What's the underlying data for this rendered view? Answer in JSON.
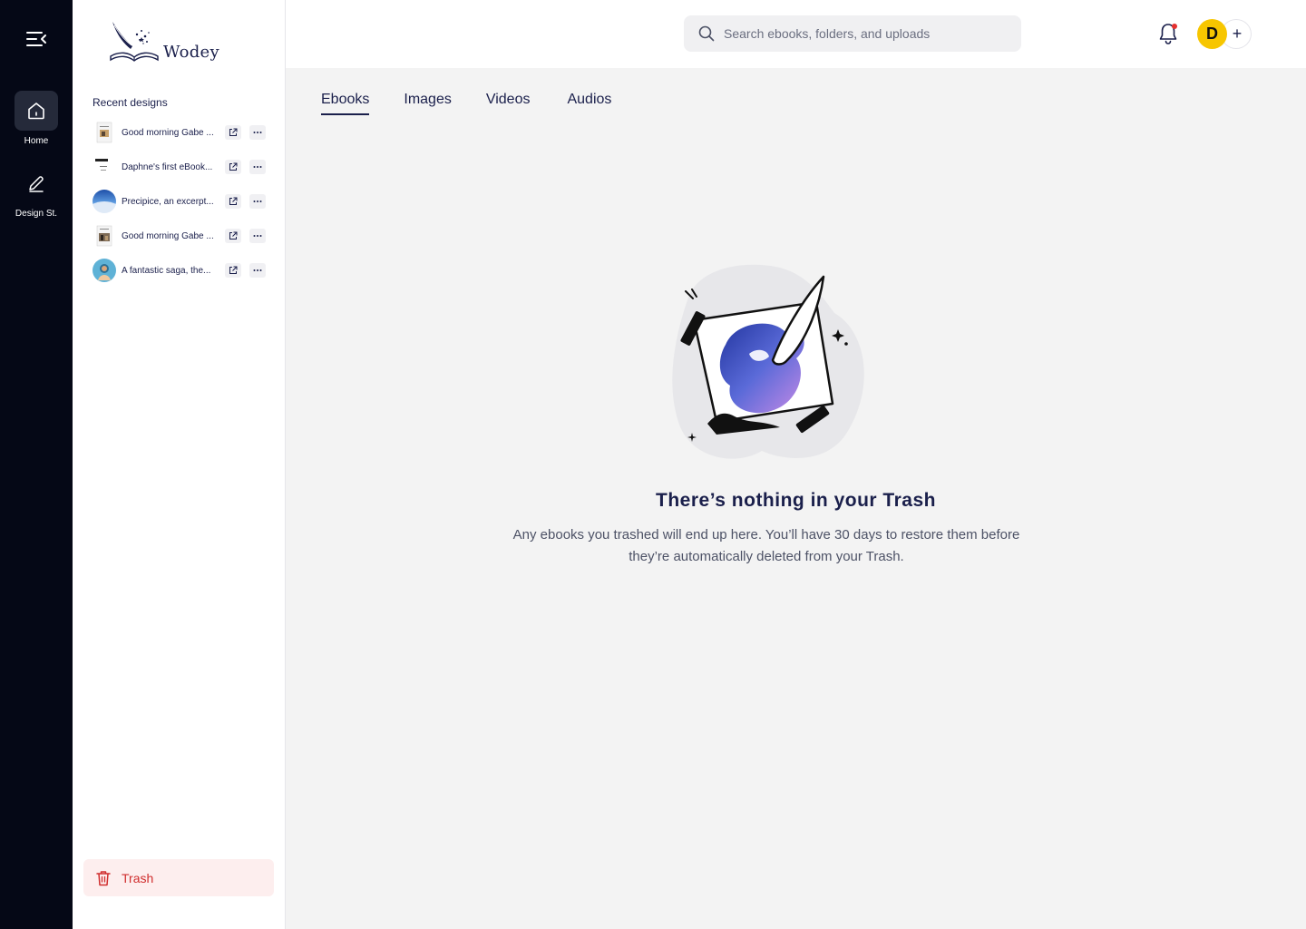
{
  "app": {
    "name": "Wodey"
  },
  "rail": {
    "items": [
      {
        "label": "Home"
      },
      {
        "label": "Design St."
      }
    ]
  },
  "sidebar": {
    "recent_title": "Recent designs",
    "recent": [
      {
        "name": "Good morning Gabe ..."
      },
      {
        "name": "Daphne's first eBook..."
      },
      {
        "name": "Precipice, an excerpt..."
      },
      {
        "name": "Good morning Gabe ..."
      },
      {
        "name": "A fantastic saga, the..."
      }
    ],
    "trash_label": "Trash"
  },
  "search": {
    "placeholder": "Search ebooks, folders, and uploads"
  },
  "user": {
    "initial": "D",
    "add_symbol": "+"
  },
  "tabs": [
    {
      "label": "Ebooks"
    },
    {
      "label": "Images"
    },
    {
      "label": "Videos"
    },
    {
      "label": "Audios"
    }
  ],
  "empty": {
    "title": "There’s nothing in your Trash",
    "text": "Any ebooks you trashed will end up here. You’ll have 30 days to restore them before they’re automatically deleted from your Trash."
  },
  "colors": {
    "rail_bg": "#050816",
    "text_primary": "#1a1f4b",
    "trash_red": "#d02d2d",
    "avatar_yellow": "#f7c600",
    "notification_dot": "#e5302f"
  },
  "icons": {
    "menu": "menu-collapse-icon",
    "home": "home-icon",
    "design": "pen-icon",
    "search": "search-icon",
    "bell": "bell-icon",
    "open": "external-link-icon",
    "more": "more-dots-icon",
    "trash": "trash-icon"
  }
}
